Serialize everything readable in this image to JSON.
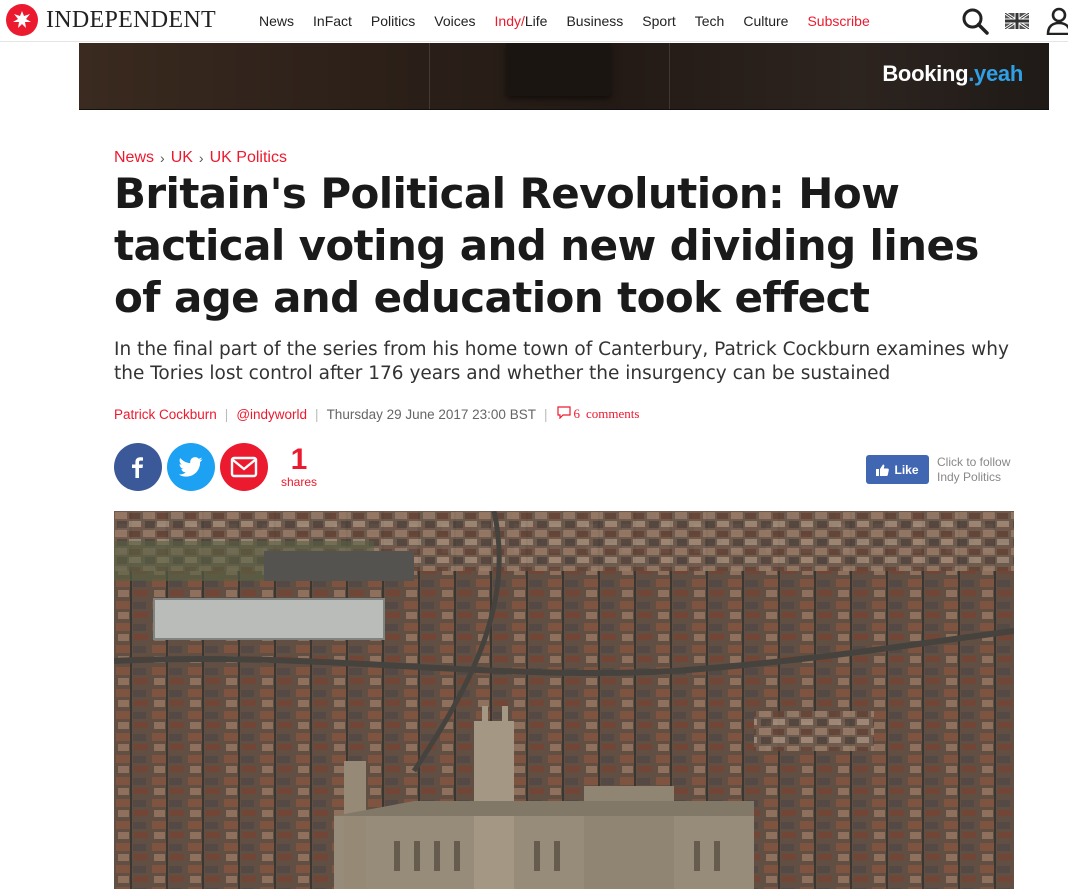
{
  "site": {
    "logo_text": "INDEPENDENT",
    "brand_color": "#ec1a2e"
  },
  "nav": {
    "items": [
      "News",
      "InFact",
      "Politics",
      "Voices",
      "Indy/Life",
      "Business",
      "Sport",
      "Tech",
      "Culture"
    ],
    "indy_prefix": "Indy/",
    "indy_suffix": "Life",
    "subscribe": "Subscribe",
    "icons": [
      "search-icon",
      "uk-flag-icon",
      "user-icon"
    ]
  },
  "ad": {
    "brand": "Booking",
    "brand_suffix": ".yeah"
  },
  "article": {
    "breadcrumb": [
      "News",
      "UK",
      "UK Politics"
    ],
    "headline": "Britain's Political Revolution: How tactical voting and new dividing lines of age and education took effect",
    "standfirst": "In the final part of the series from his home town of Canterbury, Patrick Cockburn examines why the Tories lost control after 176 years and whether the insurgency can be sustained",
    "author": "Patrick Cockburn",
    "author_handle": "@indyworld",
    "date": "Thursday 29 June 2017 23:00 BST",
    "comments_count": "6",
    "comments_label": "comments"
  },
  "share": {
    "buttons": [
      "facebook-icon",
      "twitter-icon",
      "email-icon"
    ],
    "count": "1",
    "count_label": "shares",
    "like_label": "Like",
    "follow_text": "Click to follow Indy Politics",
    "facebook_color": "#3b5998",
    "twitter_color": "#1da1f2"
  }
}
